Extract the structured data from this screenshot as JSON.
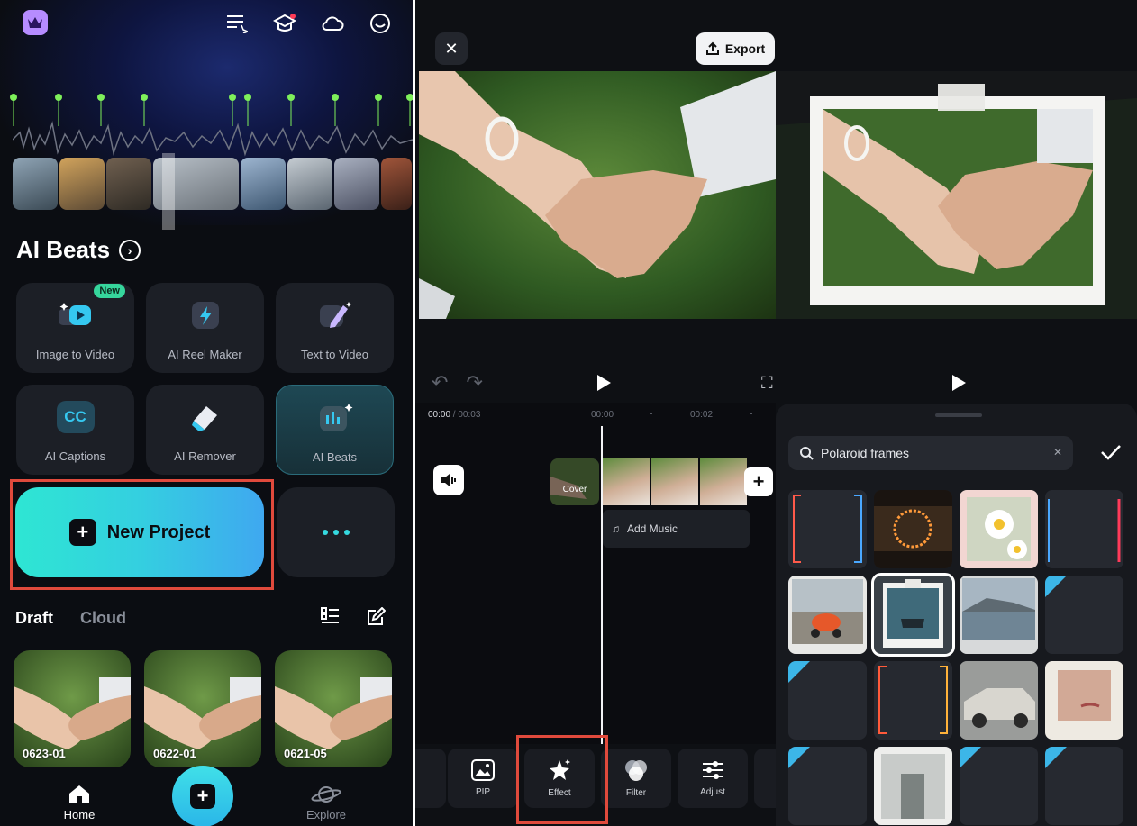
{
  "home": {
    "section_title": "AI Beats",
    "tools": [
      {
        "label": "Image to Video",
        "badge": "New"
      },
      {
        "label": "AI Reel Maker"
      },
      {
        "label": "Text to Video"
      },
      {
        "label": "AI Captions",
        "icon_text": "CC"
      },
      {
        "label": "AI Remover"
      },
      {
        "label": "AI Beats"
      }
    ],
    "new_project_label": "New Project",
    "tabs": [
      "Draft",
      "Cloud"
    ],
    "drafts": [
      "0623-01",
      "0622-01",
      "0621-05"
    ],
    "nav": {
      "home": "Home",
      "explore": "Explore"
    }
  },
  "editor": {
    "export_label": "Export",
    "timecode_current": "00:00",
    "timecode_total": " / 00:03",
    "ticks": [
      "00:00",
      "00:02"
    ],
    "cover_label": "Cover",
    "add_music_label": "Add Music",
    "toolbar": [
      "PIP",
      "Effect",
      "Filter",
      "Adjust"
    ]
  },
  "effects": {
    "search_value": "Polaroid frames"
  },
  "colors": {
    "accent_cyan": "#2ee6d3",
    "highlight_red": "#e04a3c",
    "new_badge": "#36d69c"
  }
}
